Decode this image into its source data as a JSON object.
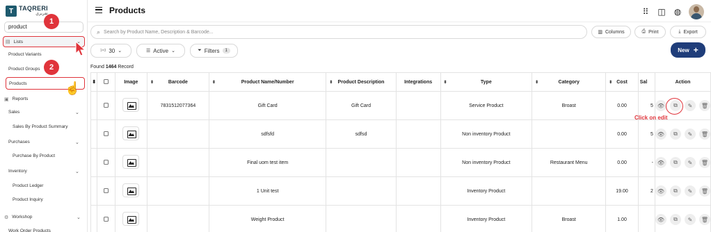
{
  "brand": {
    "name": "TAQRERI",
    "name_ar": "تقريري"
  },
  "sidebar": {
    "search_value": "product",
    "items": {
      "lists": "Lists",
      "product_variants": "Product Variants",
      "product_groups": "Product Groups",
      "products": "Products",
      "reports": "Reports",
      "sales": "Sales",
      "sales_by_product_summary": "Sales By Product Summary",
      "purchases": "Purchases",
      "purchase_by_product": "Purchase By Product",
      "inventory": "Inventory",
      "product_ledger": "Product Ledger",
      "product_inquiry": "Product Inquiry",
      "workshop": "Workshop",
      "work_order_products": "Work Order Products"
    }
  },
  "annotations": {
    "step1": "1",
    "step2": "2",
    "click_on_edit": "Click on edit",
    "accent": "#e0343b"
  },
  "header": {
    "title": "Products"
  },
  "toolbar": {
    "search_placeholder": "Search by Product Name, Description & Barcode...",
    "columns": "Columns",
    "print": "Print",
    "export": "Export",
    "page_size": "30",
    "page_size_prefix": "1=3",
    "status": "Active",
    "filters": "Filters",
    "filters_count": "1",
    "new": "New"
  },
  "found": {
    "prefix": "Found",
    "count": "1464",
    "suffix": "Record"
  },
  "table": {
    "headers": [
      "Image",
      "Barcode",
      "Product Name/Number",
      "Product Description",
      "Integrations",
      "Type",
      "Category",
      "Cost",
      "Sal",
      "Action"
    ],
    "rows": [
      {
        "barcode": "7831512077364",
        "name": "Gift Card",
        "description": "Gift Card",
        "integrations": "",
        "type": "Service Product",
        "category": "Broast",
        "cost": "0.00",
        "sale": "5"
      },
      {
        "barcode": "",
        "name": "sdfsfd",
        "description": "sdfsd",
        "integrations": "",
        "type": "Non inventory Product",
        "category": "",
        "cost": "0.00",
        "sale": "5"
      },
      {
        "barcode": "",
        "name": "Final uom test item",
        "description": "",
        "integrations": "",
        "type": "Non inventory Product",
        "category": "Restaurant Menu",
        "cost": "0.00",
        "sale": "-"
      },
      {
        "barcode": "",
        "name": "1 Unit test",
        "description": "",
        "integrations": "",
        "type": "Inventory Product",
        "category": "",
        "cost": "19.00",
        "sale": "2"
      },
      {
        "barcode": "",
        "name": "Weight Product",
        "description": "",
        "integrations": "",
        "type": "Inventory Product",
        "category": "Broast",
        "cost": "1.00",
        "sale": ""
      }
    ]
  }
}
